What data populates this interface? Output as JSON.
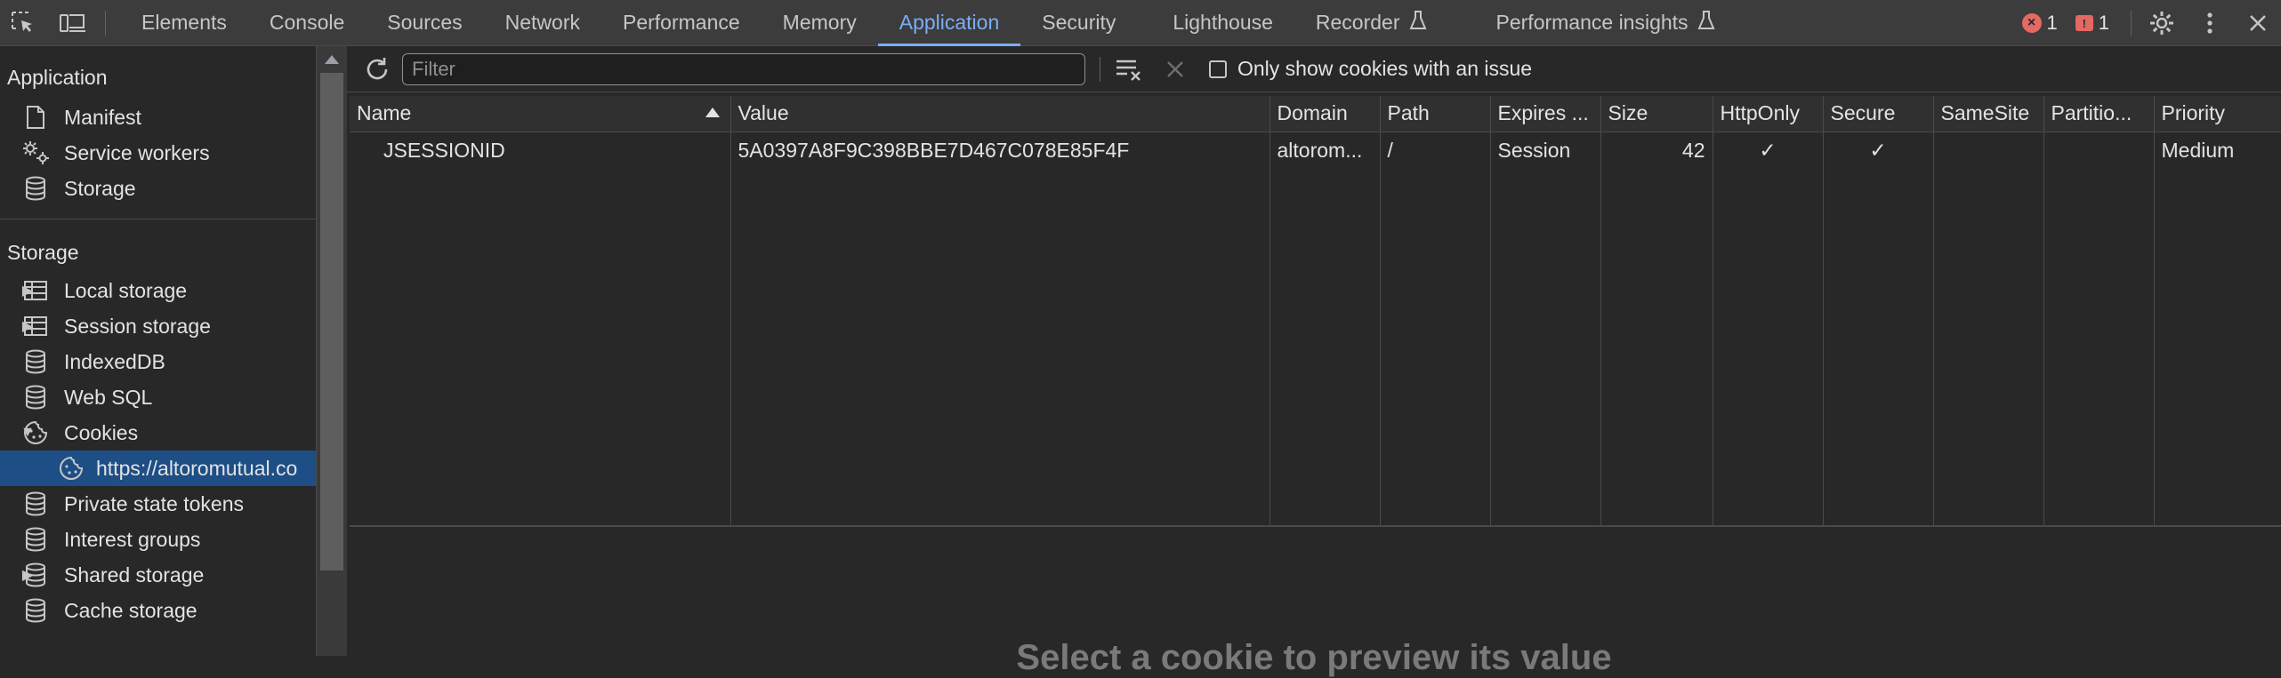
{
  "topbar": {
    "tabs": [
      {
        "label": "Elements"
      },
      {
        "label": "Console"
      },
      {
        "label": "Sources"
      },
      {
        "label": "Network"
      },
      {
        "label": "Performance"
      },
      {
        "label": "Memory"
      },
      {
        "label": "Application"
      },
      {
        "label": "Security"
      },
      {
        "label": "Lighthouse"
      },
      {
        "label": "Recorder"
      },
      {
        "label": "Performance insights"
      }
    ],
    "active_tab": "Application",
    "error_count": "1",
    "issue_count": "1"
  },
  "sidebar": {
    "application_header": "Application",
    "application_items": [
      {
        "label": "Manifest",
        "icon": "document-icon"
      },
      {
        "label": "Service workers",
        "icon": "gears-icon"
      },
      {
        "label": "Storage",
        "icon": "database-icon"
      }
    ],
    "storage_header": "Storage",
    "storage_items": [
      {
        "label": "Local storage",
        "icon": "table-icon",
        "expandable": true
      },
      {
        "label": "Session storage",
        "icon": "table-icon",
        "expandable": true
      },
      {
        "label": "IndexedDB",
        "icon": "database-icon"
      },
      {
        "label": "Web SQL",
        "icon": "database-icon"
      },
      {
        "label": "Cookies",
        "icon": "cookie-icon",
        "expanded": true
      },
      {
        "label": "https://altoromutual.co",
        "icon": "cookie-icon",
        "selected": true
      },
      {
        "label": "Private state tokens",
        "icon": "database-icon"
      },
      {
        "label": "Interest groups",
        "icon": "database-icon"
      },
      {
        "label": "Shared storage",
        "icon": "database-icon",
        "expandable": true
      },
      {
        "label": "Cache storage",
        "icon": "database-icon"
      }
    ]
  },
  "toolbar": {
    "filter_placeholder": "Filter",
    "only_issues_label": "Only show cookies with an issue"
  },
  "table": {
    "columns": [
      "Name",
      "Value",
      "Domain",
      "Path",
      "Expires ...",
      "Size",
      "HttpOnly",
      "Secure",
      "SameSite",
      "Partitio...",
      "Priority"
    ],
    "rows": [
      {
        "name": "JSESSIONID",
        "value": "5A0397A8F9C398BBE7D467C078E85F4F",
        "domain": "altorom...",
        "path": "/",
        "expires": "Session",
        "size": "42",
        "httponly": "✓",
        "secure": "✓",
        "samesite": "",
        "partition": "",
        "priority": "Medium"
      }
    ]
  },
  "preview": {
    "message": "Select a cookie to preview its value"
  }
}
